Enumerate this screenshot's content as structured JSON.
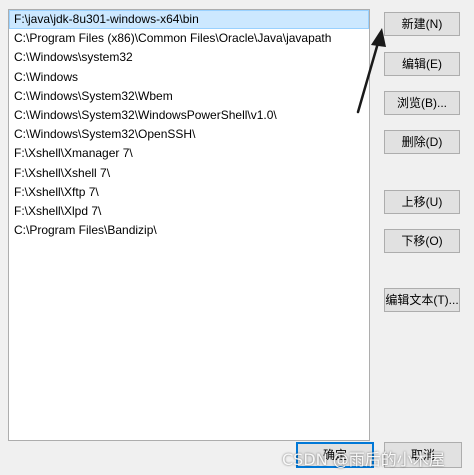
{
  "paths": [
    "F:\\java\\jdk-8u301-windows-x64\\bin",
    "C:\\Program Files (x86)\\Common Files\\Oracle\\Java\\javapath",
    "C:\\Windows\\system32",
    "C:\\Windows",
    "C:\\Windows\\System32\\Wbem",
    "C:\\Windows\\System32\\WindowsPowerShell\\v1.0\\",
    "C:\\Windows\\System32\\OpenSSH\\",
    "F:\\Xshell\\Xmanager 7\\",
    "F:\\Xshell\\Xshell 7\\",
    "F:\\Xshell\\Xftp 7\\",
    "F:\\Xshell\\Xlpd 7\\",
    "C:\\Program Files\\Bandizip\\"
  ],
  "buttons": {
    "new": "新建(N)",
    "edit": "编辑(E)",
    "browse": "浏览(B)...",
    "delete": "删除(D)",
    "move_up": "上移(U)",
    "move_down": "下移(O)",
    "edit_text": "编辑文本(T)...",
    "ok": "确定",
    "cancel": "取消"
  },
  "watermark": "CSDN @雨后的小木屋",
  "colors": {
    "selection": "#cce8ff",
    "dialog_bg": "#f0f0f0",
    "arrow": "#1a1a1a"
  }
}
